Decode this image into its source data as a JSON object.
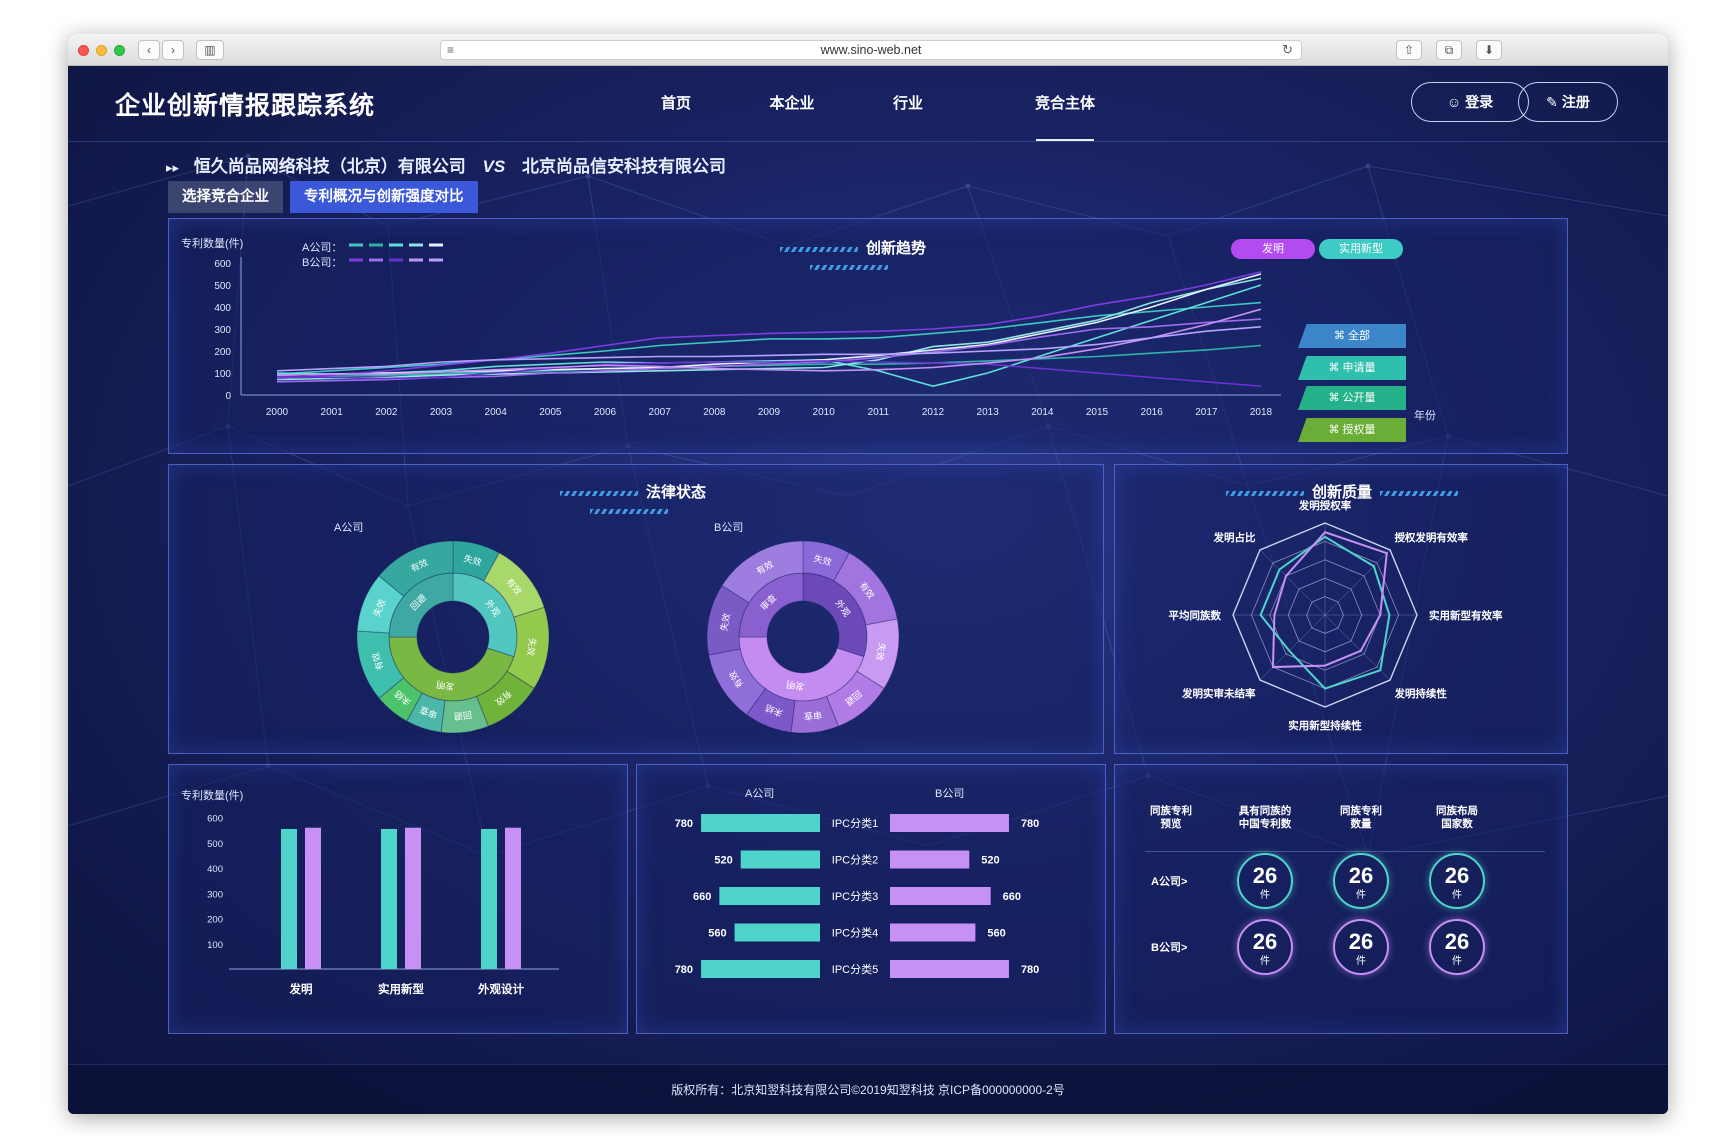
{
  "browser": {
    "url": "www.sino-web.net"
  },
  "header": {
    "title": "企业创新情报跟踪系统",
    "nav": [
      "首页",
      "本企业",
      "行业",
      "竞合主体"
    ],
    "active_nav_index": 3,
    "login": "登录",
    "register": "注册"
  },
  "compare": {
    "company_a": "恒久尚品网络科技（北京）有限公司",
    "vs": "VS",
    "company_b": "北京尚品信安科技有限公司"
  },
  "tabs": [
    "选择竞合企业",
    "专利概况与创新强度对比"
  ],
  "trend": {
    "title": "创新趋势",
    "y_label": "专利数量(件)",
    "x_label": "年份",
    "legend_a": "A公司：",
    "legend_b": "B公司：",
    "tags": [
      "发明",
      "实用新型"
    ],
    "side_tags": [
      "全部",
      "申请量",
      "公开量",
      "授权量"
    ]
  },
  "legal": {
    "title": "法律状态",
    "a_label": "A公司",
    "b_label": "B公司"
  },
  "quality": {
    "title": "创新质量",
    "axes": [
      "发明授权率",
      "授权发明有效率",
      "实用新型有效率",
      "发明持续性",
      "实用新型持续性",
      "发明实审未结率",
      "平均同族数",
      "发明占比"
    ]
  },
  "bar": {
    "y_label": "专利数量(件)",
    "categories": [
      "发明",
      "实用新型",
      "外观设计"
    ]
  },
  "ipc": {
    "a_label": "A公司",
    "b_label": "B公司"
  },
  "family": {
    "headers": [
      "同族专利\n预览",
      "具有同族的\n中国专利数",
      "同族专利\n数量",
      "同族布局\n国家数"
    ],
    "rows": [
      {
        "label": "A公司>",
        "values": [
          "26",
          "26",
          "26"
        ]
      },
      {
        "label": "B公司>",
        "values": [
          "26",
          "26",
          "26"
        ]
      }
    ],
    "unit": "件"
  },
  "footer": "版权所有：北京知翌科技有限公司©2019知翌科技 京ICP备000000000-2号",
  "colors": {
    "accent_teal": "#4fd4cc",
    "accent_purple": "#c690f5",
    "green": "#7dbb3c",
    "active_tab": "#3b58d8"
  },
  "chart_data": [
    {
      "type": "line",
      "title": "创新趋势",
      "ylabel": "专利数量(件)",
      "xlabel": "年份",
      "x": [
        "2000",
        "2001",
        "2002",
        "2003",
        "2004",
        "2005",
        "2006",
        "2007",
        "2008",
        "2009",
        "2010",
        "2011",
        "2012",
        "2013",
        "2014",
        "2015",
        "2016",
        "2017",
        "2018"
      ],
      "ylim": [
        0,
        600
      ],
      "yticks": [
        0,
        100,
        200,
        300,
        400,
        500,
        600
      ],
      "series": [
        {
          "name": "A1",
          "group": "A公司",
          "color": "#3cc7c0",
          "values": [
            95,
            110,
            125,
            140,
            160,
            180,
            200,
            225,
            240,
            255,
            255,
            260,
            280,
            300,
            330,
            360,
            380,
            400,
            420
          ]
        },
        {
          "name": "A2",
          "group": "A公司",
          "color": "#2db3a8",
          "values": [
            80,
            85,
            90,
            95,
            105,
            110,
            120,
            125,
            130,
            135,
            140,
            140,
            145,
            155,
            165,
            175,
            190,
            205,
            225
          ]
        },
        {
          "name": "A3",
          "group": "A公司",
          "color": "#5ee0d8",
          "values": [
            100,
            95,
            100,
            110,
            130,
            140,
            150,
            145,
            150,
            155,
            160,
            110,
            40,
            100,
            180,
            260,
            340,
            420,
            500
          ]
        },
        {
          "name": "A4",
          "group": "A公司",
          "color": "#8fe6e2",
          "values": [
            70,
            75,
            80,
            90,
            95,
            100,
            105,
            110,
            115,
            120,
            125,
            160,
            220,
            240,
            290,
            340,
            420,
            480,
            530
          ]
        },
        {
          "name": "A5",
          "group": "A公司",
          "color": "#e6f0ff",
          "values": [
            90,
            95,
            100,
            105,
            110,
            115,
            120,
            125,
            140,
            150,
            160,
            180,
            205,
            230,
            280,
            330,
            400,
            480,
            550
          ]
        },
        {
          "name": "B1",
          "group": "B公司",
          "color": "#7c3ce0",
          "values": [
            75,
            90,
            110,
            135,
            160,
            190,
            225,
            260,
            270,
            280,
            285,
            290,
            300,
            320,
            360,
            410,
            450,
            500,
            560
          ]
        },
        {
          "name": "B2",
          "group": "B公司",
          "color": "#9f6cf0",
          "values": [
            60,
            65,
            70,
            80,
            85,
            100,
            110,
            120,
            130,
            140,
            150,
            170,
            195,
            225,
            265,
            300,
            310,
            330,
            345
          ]
        },
        {
          "name": "B3",
          "group": "B公司",
          "color": "#6a2fd0",
          "values": [
            85,
            80,
            75,
            80,
            100,
            120,
            140,
            145,
            150,
            150,
            155,
            150,
            145,
            140,
            120,
            100,
            80,
            60,
            40
          ]
        },
        {
          "name": "B4",
          "group": "B公司",
          "color": "#c690f5",
          "values": [
            90,
            95,
            95,
            105,
            115,
            125,
            135,
            130,
            120,
            115,
            110,
            115,
            125,
            145,
            170,
            210,
            260,
            320,
            390
          ]
        },
        {
          "name": "B5",
          "group": "B公司",
          "color": "#b8a2ff",
          "values": [
            110,
            120,
            130,
            150,
            160,
            165,
            170,
            175,
            175,
            180,
            185,
            185,
            190,
            200,
            210,
            230,
            260,
            290,
            310
          ]
        }
      ],
      "legend": "top-left",
      "grid": false
    },
    {
      "type": "pie",
      "title": "法律状态",
      "series": [
        {
          "name": "A公司",
          "rings": [
            {
              "ring": "inner",
              "labels": [
                "外观",
                "发明",
                "回避"
              ],
              "values": [
                30,
                45,
                25
              ]
            },
            {
              "ring": "outer",
              "labels": [
                "失效",
                "有效",
                "失效",
                "有效",
                "回避",
                "审查",
                "未结",
                "有效",
                "失效",
                "有效"
              ],
              "values": [
                8,
                12,
                14,
                10,
                8,
                6,
                6,
                12,
                10,
                14
              ]
            }
          ]
        },
        {
          "name": "B公司",
          "rings": [
            {
              "ring": "inner",
              "labels": [
                "外观",
                "发明",
                "审查"
              ],
              "values": [
                30,
                45,
                25
              ]
            },
            {
              "ring": "outer",
              "labels": [
                "失效",
                "有效",
                "失效",
                "回避",
                "审查",
                "未结",
                "有效",
                "失效",
                "有效"
              ],
              "values": [
                8,
                14,
                12,
                10,
                8,
                8,
                12,
                12,
                16
              ]
            }
          ]
        }
      ]
    },
    {
      "type": "radar",
      "title": "创新质量",
      "categories": [
        "发明授权率",
        "授权发明有效率",
        "实用新型有效率",
        "发明持续性",
        "实用新型持续性",
        "发明实审未结率",
        "平均同族数",
        "发明占比"
      ],
      "series": [
        {
          "name": "A公司",
          "color": "#4fd4cc",
          "values": [
            0.85,
            0.75,
            0.7,
            0.85,
            0.8,
            0.55,
            0.7,
            0.7
          ]
        },
        {
          "name": "B公司",
          "color": "#c690f5",
          "values": [
            0.9,
            0.95,
            0.6,
            0.55,
            0.55,
            0.8,
            0.55,
            0.6
          ]
        }
      ]
    },
    {
      "type": "bar",
      "ylabel": "专利数量(件)",
      "categories": [
        "发明",
        "实用新型",
        "外观设计"
      ],
      "ylim": [
        0,
        650
      ],
      "yticks": [
        100,
        200,
        300,
        400,
        500,
        600
      ],
      "series": [
        {
          "name": "A公司",
          "color": "#4fd4cc",
          "values": [
            555,
            555,
            555
          ]
        },
        {
          "name": "B公司",
          "color": "#c690f5",
          "values": [
            560,
            560,
            560
          ]
        }
      ]
    },
    {
      "type": "bar",
      "categories": [
        "IPC分类1",
        "IPC分类2",
        "IPC分类3",
        "IPC分类4",
        "IPC分类5"
      ],
      "xlim": [
        0,
        800
      ],
      "series": [
        {
          "name": "A公司",
          "color": "#4fd4cc",
          "values": [
            780,
            520,
            660,
            560,
            780
          ]
        },
        {
          "name": "B公司",
          "color": "#c690f5",
          "values": [
            780,
            520,
            660,
            560,
            780
          ]
        }
      ]
    }
  ]
}
